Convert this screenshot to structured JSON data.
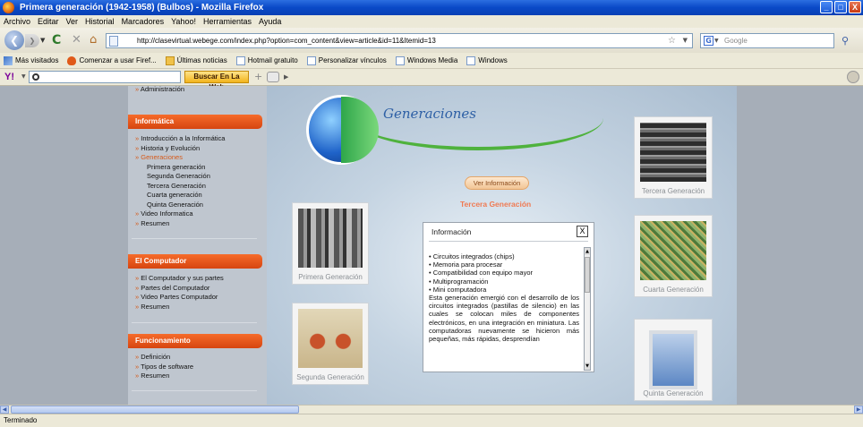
{
  "window": {
    "title": "Primera generación (1942-1958) (Bulbos) - Mozilla Firefox",
    "buttons": {
      "minimize": "_",
      "maximize": "□",
      "close": "X"
    }
  },
  "menu": [
    "Archivo",
    "Editar",
    "Ver",
    "Historial",
    "Marcadores",
    "Yahoo!",
    "Herramientas",
    "Ayuda"
  ],
  "nav": {
    "url": "http://clasevirtual.webege.com/index.php?option=com_content&view=article&id=11&Itemid=13",
    "search_placeholder": "Google"
  },
  "bookmarks": [
    {
      "label": "Más visitados",
      "icon": "most-visited-icon"
    },
    {
      "label": "Comenzar a usar Firef...",
      "icon": "firefox-icon"
    },
    {
      "label": "Últimas noticias",
      "icon": "folder-icon"
    },
    {
      "label": "Hotmail gratuito",
      "icon": "page-icon"
    },
    {
      "label": "Personalizar vínculos",
      "icon": "page-icon"
    },
    {
      "label": "Windows Media",
      "icon": "page-icon"
    },
    {
      "label": "Windows",
      "icon": "page-icon"
    }
  ],
  "yahoo": {
    "logo": "Y!",
    "search_button": "Buscar En La Web",
    "plus": "+"
  },
  "sidebar": {
    "prev_item": "Administración",
    "sections": [
      {
        "title": "Informática",
        "items": [
          {
            "label": "Introducción a la Informática"
          },
          {
            "label": "Historia y Evolución"
          },
          {
            "label": "Generaciones",
            "active": true
          },
          {
            "label": "Primera generación",
            "sub": true
          },
          {
            "label": "Segunda Generación",
            "sub": true
          },
          {
            "label": "Tercera Generación",
            "sub": true
          },
          {
            "label": "Cuarta generación",
            "sub": true
          },
          {
            "label": "Quinta Generación",
            "sub": true
          },
          {
            "label": "Video Informatica"
          },
          {
            "label": "Resumen"
          }
        ]
      },
      {
        "title": "El Computador",
        "items": [
          {
            "label": "El Computador y sus partes"
          },
          {
            "label": "Partes del Computador"
          },
          {
            "label": "Video Partes Computador"
          },
          {
            "label": "Resumen"
          }
        ]
      },
      {
        "title": "Funcionamiento",
        "items": [
          {
            "label": "Definición"
          },
          {
            "label": "Tipos de software"
          },
          {
            "label": "Resumen"
          }
        ]
      }
    ]
  },
  "main": {
    "logo_title": "Generaciones",
    "ver_button": "Ver Información",
    "current_generation": "Tercera Generación",
    "cards": {
      "primera": "Primera Generación",
      "segunda": "Segunda Generación",
      "tercera": "Tercera Generación",
      "cuarta": "Cuarta Generación",
      "quinta": "Quinta Generación"
    },
    "popup": {
      "title": "Información",
      "close": "X",
      "lines": [
        "• Circuitos integrados (chips)",
        "• Memoria para procesar",
        "• Compatibilidad con equipo mayor",
        "• Multiprogramación",
        "• Mini computadora"
      ],
      "paragraph": "Esta generación emergió con el desarrollo de los circuitos integrados (pastillas de silencio) en las cuales se colocan miles de componentes electrónicos, en una integración en miniatura. Las computadoras nuevamente se hicieron más pequeñas, más rápidas, desprendían"
    }
  },
  "status": "Terminado"
}
